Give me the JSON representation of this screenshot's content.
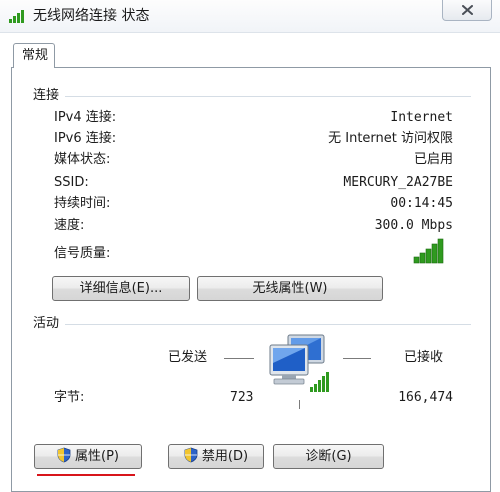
{
  "window": {
    "title": "无线网络连接 状态",
    "title_icon": "wifi-signal-icon",
    "close_icon": "close-icon"
  },
  "tabs": [
    {
      "label": "常规",
      "active": true
    }
  ],
  "connection": {
    "group_label": "连接",
    "rows": [
      {
        "label": "IPv4 连接:",
        "value": "Internet"
      },
      {
        "label": "IPv6 连接:",
        "value": "无 Internet 访问权限"
      },
      {
        "label": "媒体状态:",
        "value": "已启用"
      },
      {
        "label": "SSID:",
        "value": "MERCURY_2A27BE"
      },
      {
        "label": "持续时间:",
        "value": "00:14:45"
      },
      {
        "label": "速度:",
        "value": "300.0 Mbps"
      }
    ],
    "signal_label": "信号质量:",
    "signal_icon": "signal-strength-icon",
    "details_button": "详细信息(E)...",
    "wireless_props_button": "无线属性(W)"
  },
  "activity": {
    "group_label": "活动",
    "sent_label": "已发送",
    "received_label": "已接收",
    "bytes_label": "字节:",
    "bytes_sent": "723",
    "bytes_received": "166,474",
    "network_icon": "network-computers-icon"
  },
  "bottom_buttons": {
    "properties": "属性(P)",
    "disable": "禁用(D)",
    "diagnose": "诊断(G)"
  },
  "colors": {
    "signal_green": "#2f9a1f",
    "highlight_red": "#d8151b"
  }
}
